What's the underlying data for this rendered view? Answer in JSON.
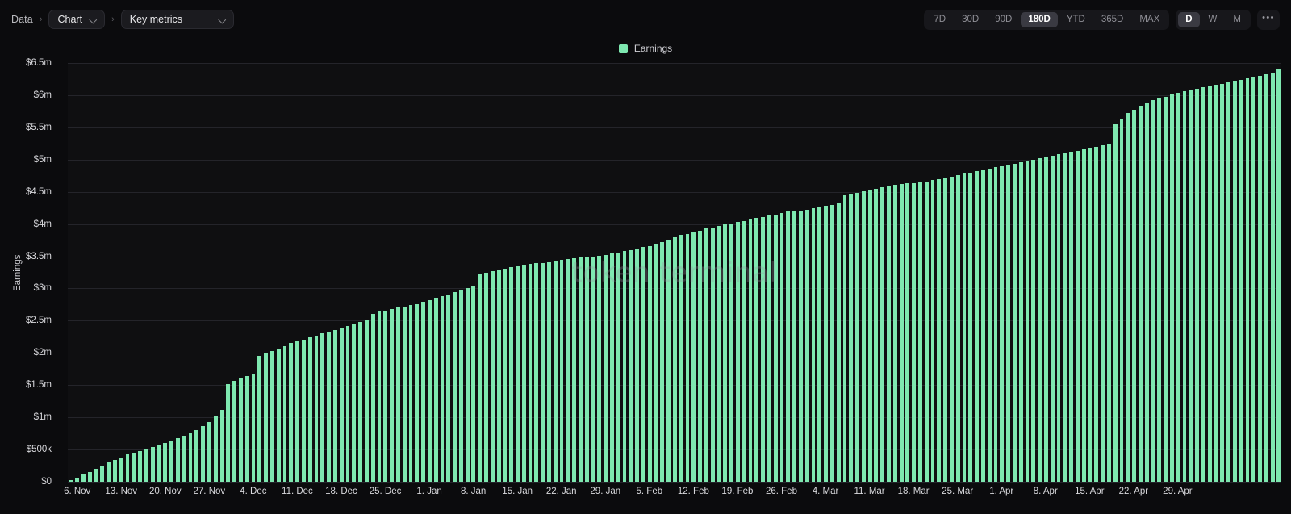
{
  "breadcrumb": {
    "root_label": "Data",
    "separator": "›",
    "chart_select": {
      "label": "Chart",
      "icon": "chevron-down-icon"
    },
    "metric_select": {
      "label": "Key metrics",
      "icon": "chevron-down-icon"
    }
  },
  "range_controls": {
    "periods": [
      {
        "label": "7D",
        "active": false
      },
      {
        "label": "30D",
        "active": false
      },
      {
        "label": "90D",
        "active": false
      },
      {
        "label": "180D",
        "active": true
      },
      {
        "label": "YTD",
        "active": false
      },
      {
        "label": "365D",
        "active": false
      },
      {
        "label": "MAX",
        "active": false
      }
    ],
    "granularity": [
      {
        "label": "D",
        "active": true
      },
      {
        "label": "W",
        "active": false
      },
      {
        "label": "M",
        "active": false
      }
    ],
    "more_label": "•••",
    "more_icon": "ellipsis-icon"
  },
  "legend": [
    {
      "label": "Earnings",
      "color": "#7ee8b0"
    }
  ],
  "watermark": "token terminal",
  "colors": {
    "background": "#0b0b0d",
    "plot_background": "#0f0f11",
    "gridline": "#24242a",
    "series": "#7ee8b0",
    "active_pill": "#3a3a42"
  },
  "chart_data": {
    "type": "bar",
    "title": "",
    "xlabel": "",
    "ylabel": "Earnings",
    "legend_position": "top-center",
    "grid": true,
    "ylim": [
      0,
      6500000
    ],
    "ytick_labels": [
      "$0",
      "$500k",
      "$1m",
      "$1.5m",
      "$2m",
      "$2.5m",
      "$3m",
      "$3.5m",
      "$4m",
      "$4.5m",
      "$5m",
      "$5.5m",
      "$6m",
      "$6.5m"
    ],
    "ytick_values": [
      0,
      500000,
      1000000,
      1500000,
      2000000,
      2500000,
      3000000,
      3500000,
      4000000,
      4500000,
      5000000,
      5500000,
      6000000,
      6500000
    ],
    "xtick_labels": [
      "6. Nov",
      "13. Nov",
      "20. Nov",
      "27. Nov",
      "4. Dec",
      "11. Dec",
      "18. Dec",
      "25. Dec",
      "1. Jan",
      "8. Jan",
      "15. Jan",
      "22. Jan",
      "29. Jan",
      "5. Feb",
      "12. Feb",
      "19. Feb",
      "26. Feb",
      "4. Mar",
      "11. Mar",
      "18. Mar",
      "25. Mar",
      "1. Apr",
      "8. Apr",
      "15. Apr",
      "22. Apr",
      "29. Apr"
    ],
    "xtick_indices": [
      1,
      8,
      15,
      22,
      29,
      36,
      43,
      50,
      57,
      64,
      71,
      78,
      85,
      92,
      99,
      106,
      113,
      120,
      127,
      134,
      141,
      148,
      155,
      162,
      169,
      176
    ],
    "series": [
      {
        "name": "Earnings",
        "color": "#7ee8b0",
        "values": [
          20000,
          60000,
          110000,
          150000,
          200000,
          250000,
          300000,
          340000,
          380000,
          420000,
          455000,
          480000,
          510000,
          540000,
          570000,
          600000,
          640000,
          680000,
          720000,
          760000,
          800000,
          860000,
          930000,
          1020000,
          1120000,
          1520000,
          1560000,
          1600000,
          1640000,
          1680000,
          1950000,
          1990000,
          2030000,
          2070000,
          2110000,
          2150000,
          2180000,
          2210000,
          2240000,
          2270000,
          2300000,
          2330000,
          2360000,
          2390000,
          2420000,
          2450000,
          2480000,
          2510000,
          2610000,
          2640000,
          2660000,
          2680000,
          2700000,
          2720000,
          2740000,
          2760000,
          2790000,
          2820000,
          2850000,
          2880000,
          2910000,
          2940000,
          2970000,
          3000000,
          3030000,
          3220000,
          3250000,
          3270000,
          3290000,
          3310000,
          3330000,
          3350000,
          3360000,
          3380000,
          3390000,
          3400000,
          3410000,
          3430000,
          3450000,
          3460000,
          3470000,
          3480000,
          3490000,
          3500000,
          3510000,
          3520000,
          3540000,
          3560000,
          3580000,
          3600000,
          3620000,
          3640000,
          3660000,
          3680000,
          3720000,
          3760000,
          3800000,
          3830000,
          3850000,
          3870000,
          3900000,
          3930000,
          3950000,
          3970000,
          3990000,
          4010000,
          4030000,
          4050000,
          4070000,
          4090000,
          4110000,
          4130000,
          4150000,
          4170000,
          4190000,
          4200000,
          4210000,
          4220000,
          4240000,
          4260000,
          4280000,
          4300000,
          4320000,
          4450000,
          4470000,
          4490000,
          4510000,
          4530000,
          4550000,
          4570000,
          4590000,
          4610000,
          4620000,
          4630000,
          4640000,
          4650000,
          4660000,
          4680000,
          4700000,
          4720000,
          4740000,
          4760000,
          4780000,
          4800000,
          4820000,
          4840000,
          4860000,
          4880000,
          4900000,
          4920000,
          4940000,
          4960000,
          4980000,
          5000000,
          5020000,
          5040000,
          5060000,
          5080000,
          5100000,
          5120000,
          5140000,
          5160000,
          5180000,
          5200000,
          5220000,
          5240000,
          5550000,
          5640000,
          5720000,
          5780000,
          5840000,
          5880000,
          5920000,
          5950000,
          5980000,
          6010000,
          6040000,
          6060000,
          6080000,
          6100000,
          6120000,
          6140000,
          6160000,
          6180000,
          6200000,
          6220000,
          6240000,
          6260000,
          6280000,
          6300000,
          6320000,
          6340000,
          6400000
        ]
      }
    ]
  }
}
